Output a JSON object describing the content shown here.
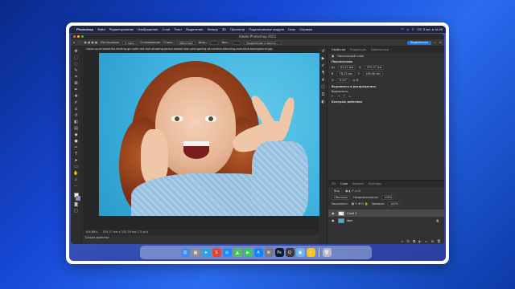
{
  "menubar": {
    "app_name": "Photoshop",
    "items": [
      "Файл",
      "Редактирование",
      "Изображение",
      "Слои",
      "Текст",
      "Выделение",
      "Фильтр",
      "3D",
      "Просмотр",
      "Подключаемые модули",
      "Окно",
      "Справка"
    ],
    "clock": "Сб, 5 окт. в 14:26"
  },
  "window": {
    "title": "Adobe Photoshop 2022",
    "share_label": "Поделиться"
  },
  "options_bar": {
    "feather_label": "Растушевка:",
    "feather_value": "0 пикс",
    "smoothing_label": "Сглаживание",
    "style_label": "Стиль:",
    "style_value": "Обычный",
    "width_label": "Шир.:",
    "height_label": "Выс.:",
    "select_mask_label": "Выделение и маска..."
  },
  "document": {
    "tab_title": "close-up-of-beautiful-smiling-girl-with-red-hair-showing-peace-kawaii-sign-and-gazing-at-camera-standing-over-blue-background.jpg",
    "zoom": "104,68%",
    "doc_info": "529,17 мм x 352,78 мм (72 ppi)",
    "history_label": "Шкала времени"
  },
  "properties": {
    "tabs": [
      "Свойства",
      "Коррекция",
      "Библиотеки"
    ],
    "layer_kind": "Пиксельный слой",
    "transform_title": "Перспектива",
    "w_value": "93,97 мм",
    "h_value": "78,23 мм",
    "x_value": "373,37 мм",
    "y_value": "108,98 мм",
    "angle_value": "0,00°",
    "align_title": "Выровнять и распределить",
    "align_sub": "Выровнять:",
    "quick_actions_title": "Быстрые действия"
  },
  "layers": {
    "tabs": [
      "3D",
      "Слои",
      "Каналы",
      "Контуры"
    ],
    "filter_label": "Вид",
    "blend_mode": "Обычные",
    "opacity_label": "Непрозрачность:",
    "opacity_value": "100%",
    "lock_label": "Закрепить:",
    "fill_label": "Заливка:",
    "fill_value": "100%",
    "items": [
      {
        "name": "Слой 1",
        "selected": true
      },
      {
        "name": "Фон",
        "selected": false
      }
    ]
  },
  "dock": {
    "apps": [
      {
        "icon": "finder-icon",
        "color": "#3b8cf0",
        "glyph": "☺"
      },
      {
        "icon": "launchpad-icon",
        "color": "#8e8e93",
        "glyph": "▦"
      },
      {
        "icon": "telegram-icon",
        "color": "#2aa3e0",
        "glyph": "➤"
      },
      {
        "icon": "app-icon",
        "color": "#e0443a",
        "glyph": "S"
      },
      {
        "icon": "safari-icon",
        "color": "#1a8cff",
        "glyph": "◎"
      },
      {
        "icon": "maps-icon",
        "color": "#4cc35a",
        "glyph": "▲"
      },
      {
        "icon": "facetime-icon",
        "color": "#34c759",
        "glyph": "▶"
      },
      {
        "icon": "appstore-icon",
        "color": "#0a84ff",
        "glyph": "A"
      },
      {
        "icon": "settings-icon",
        "color": "#7a7a80",
        "glyph": "⚙"
      },
      {
        "icon": "photoshop-icon",
        "color": "#0b1b34",
        "glyph": "Ps"
      },
      {
        "icon": "quicktime-icon",
        "color": "#3a3a3c",
        "glyph": "Q"
      },
      {
        "icon": "preview-icon",
        "color": "#6ab0f3",
        "glyph": "▣"
      },
      {
        "icon": "lightning-icon",
        "color": "#f5c518",
        "glyph": "⚡"
      },
      {
        "icon": "trash-icon",
        "color": "#b8b8c0",
        "glyph": "🗑"
      }
    ]
  }
}
